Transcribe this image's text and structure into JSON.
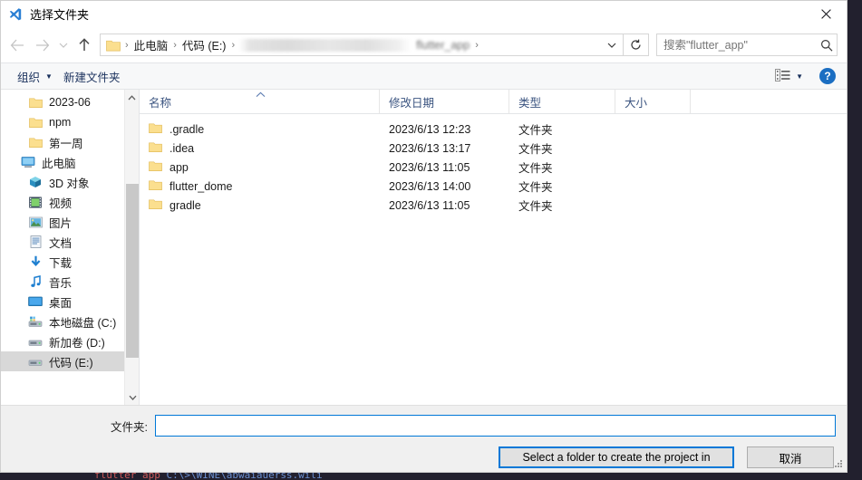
{
  "window": {
    "title": "选择文件夹",
    "title_icon": "vscode-icon",
    "close_label": "✕"
  },
  "nav": {
    "back_icon": "arrow-left-icon",
    "forward_icon": "arrow-right-icon",
    "recent_icon": "chevron-down-icon",
    "up_icon": "arrow-up-icon",
    "refresh_icon": "refresh-icon",
    "dropdown_icon": "chevron-down-icon"
  },
  "address": {
    "folder_icon": "folder-icon",
    "crumbs": [
      {
        "label": "此电脑",
        "blurred": false
      },
      {
        "label": "代码 (E:)",
        "blurred": false
      },
      {
        "label": "",
        "blurred": true
      },
      {
        "label": "flutter_app",
        "blurred": true
      }
    ],
    "separator": "›"
  },
  "search": {
    "value": "",
    "placeholder": "搜索\"flutter_app\"",
    "icon": "search-icon"
  },
  "toolbar": {
    "organize_label": "组织",
    "organize_caret": "▼",
    "new_folder_label": "新建文件夹",
    "view_mode_icon": "view-list-icon",
    "view_caret": "▼",
    "help_label": "?"
  },
  "sidebar": {
    "items": [
      {
        "label": "2023-06",
        "icon": "folder-icon",
        "indent": 1,
        "selected": false
      },
      {
        "label": "npm",
        "icon": "folder-icon",
        "indent": 1,
        "selected": false
      },
      {
        "label": "第一周",
        "icon": "folder-icon",
        "indent": 1,
        "selected": false
      },
      {
        "label": "此电脑",
        "icon": "this-pc-icon",
        "indent": 0,
        "selected": false
      },
      {
        "label": "3D 对象",
        "icon": "3d-objects-icon",
        "indent": 1,
        "selected": false
      },
      {
        "label": "视频",
        "icon": "videos-icon",
        "indent": 1,
        "selected": false
      },
      {
        "label": "图片",
        "icon": "pictures-icon",
        "indent": 1,
        "selected": false
      },
      {
        "label": "文档",
        "icon": "documents-icon",
        "indent": 1,
        "selected": false
      },
      {
        "label": "下载",
        "icon": "downloads-icon",
        "indent": 1,
        "selected": false
      },
      {
        "label": "音乐",
        "icon": "music-icon",
        "indent": 1,
        "selected": false
      },
      {
        "label": "桌面",
        "icon": "desktop-icon",
        "indent": 1,
        "selected": false
      },
      {
        "label": "本地磁盘 (C:)",
        "icon": "system-drive-icon",
        "indent": 1,
        "selected": false
      },
      {
        "label": "新加卷 (D:)",
        "icon": "drive-icon",
        "indent": 1,
        "selected": false
      },
      {
        "label": "代码 (E:)",
        "icon": "drive-icon",
        "indent": 1,
        "selected": true
      }
    ],
    "scroll_up_icon": "chevron-up-icon",
    "scroll_down_icon": "chevron-down-icon"
  },
  "filelist": {
    "columns": [
      {
        "label": "名称",
        "sorted": "asc"
      },
      {
        "label": "修改日期",
        "sorted": ""
      },
      {
        "label": "类型",
        "sorted": ""
      },
      {
        "label": "大小",
        "sorted": ""
      }
    ],
    "sort_caret": "︿",
    "rows": [
      {
        "name": ".gradle",
        "date": "2023/6/13 12:23",
        "type": "文件夹",
        "size": "",
        "icon": "folder-icon"
      },
      {
        "name": ".idea",
        "date": "2023/6/13 13:17",
        "type": "文件夹",
        "size": "",
        "icon": "folder-icon"
      },
      {
        "name": "app",
        "date": "2023/6/13 11:05",
        "type": "文件夹",
        "size": "",
        "icon": "folder-icon"
      },
      {
        "name": "flutter_dome",
        "date": "2023/6/13 14:00",
        "type": "文件夹",
        "size": "",
        "icon": "folder-icon"
      },
      {
        "name": "gradle",
        "date": "2023/6/13 11:05",
        "type": "文件夹",
        "size": "",
        "icon": "folder-icon"
      }
    ]
  },
  "footer": {
    "folder_label": "文件夹:",
    "folder_value": "",
    "folder_placeholder": "",
    "select_button": "Select a folder to create the project in",
    "cancel_button": "取消"
  },
  "background": {
    "terminal_text_red": "flutter app",
    "terminal_text_blue": "C:\\>\\WINE\\abwaiauerss.wili"
  },
  "colors": {
    "accent": "#0078d7",
    "folder_yellow": "#f8d775",
    "column_header_text": "#3b5480",
    "toolbar_text": "#19305c",
    "selection_grey": "#d8d8d8"
  }
}
